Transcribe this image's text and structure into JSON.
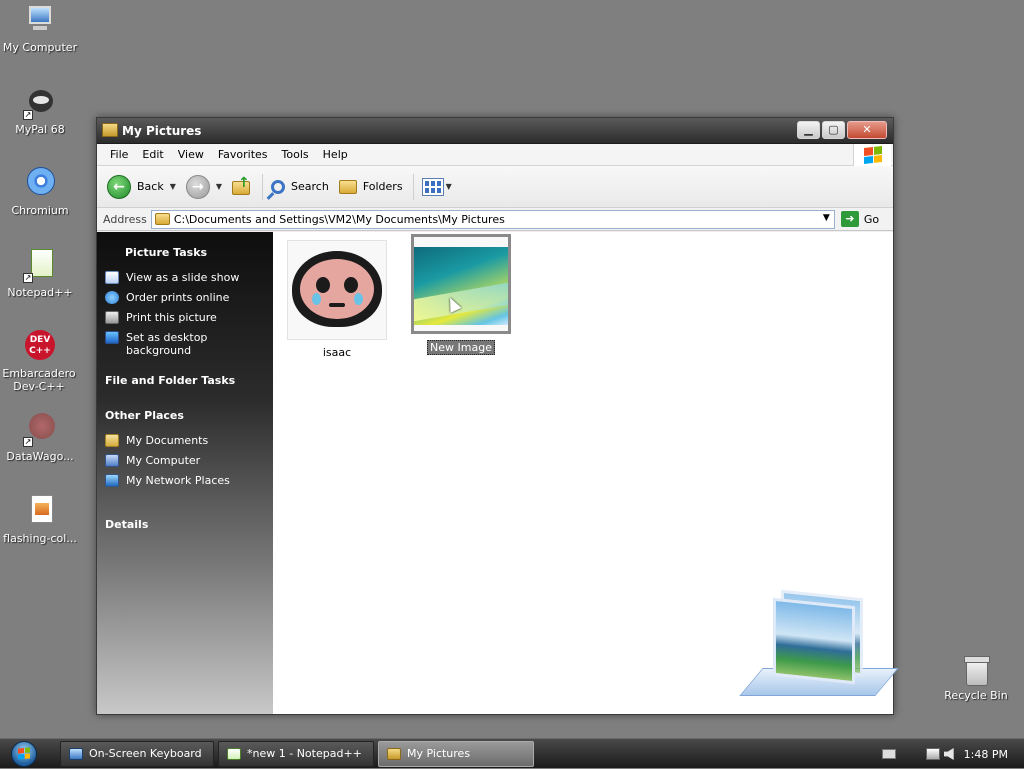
{
  "desktop": {
    "icons": [
      {
        "label": "My Computer"
      },
      {
        "label": "MyPal 68"
      },
      {
        "label": "Chromium"
      },
      {
        "label": "Notepad++"
      },
      {
        "label": "Embarcadero Dev-C++"
      },
      {
        "label": "DataWago..."
      },
      {
        "label": "flashing-col..."
      }
    ],
    "recycle_bin": "Recycle Bin"
  },
  "window": {
    "title": "My Pictures",
    "menu": [
      "File",
      "Edit",
      "View",
      "Favorites",
      "Tools",
      "Help"
    ],
    "toolbar": {
      "back": "Back",
      "search": "Search",
      "folders": "Folders"
    },
    "address": {
      "label": "Address",
      "path": "C:\\Documents and Settings\\VM2\\My Documents\\My Pictures",
      "go": "Go"
    },
    "taskpane": {
      "picture_tasks_title": "Picture Tasks",
      "picture_tasks": [
        "View as a slide show",
        "Order prints online",
        "Print this picture",
        "Set as desktop background"
      ],
      "file_folder_title": "File and Folder Tasks",
      "other_places_title": "Other Places",
      "other_places": [
        "My Documents",
        "My Computer",
        "My Network Places"
      ],
      "details_title": "Details"
    },
    "files": [
      {
        "name": "isaac",
        "selected": false
      },
      {
        "name": "New Image",
        "selected": true
      }
    ]
  },
  "taskbar": {
    "buttons": [
      {
        "label": "On-Screen Keyboard",
        "active": false
      },
      {
        "label": "*new 1 - Notepad++",
        "active": false
      },
      {
        "label": "My Pictures",
        "active": true
      }
    ],
    "clock": "1:48 PM"
  },
  "colors": {
    "desktop_bg": "#7f7f7f",
    "taskpane_top": "#0e0e0e",
    "selection": "#777777"
  }
}
